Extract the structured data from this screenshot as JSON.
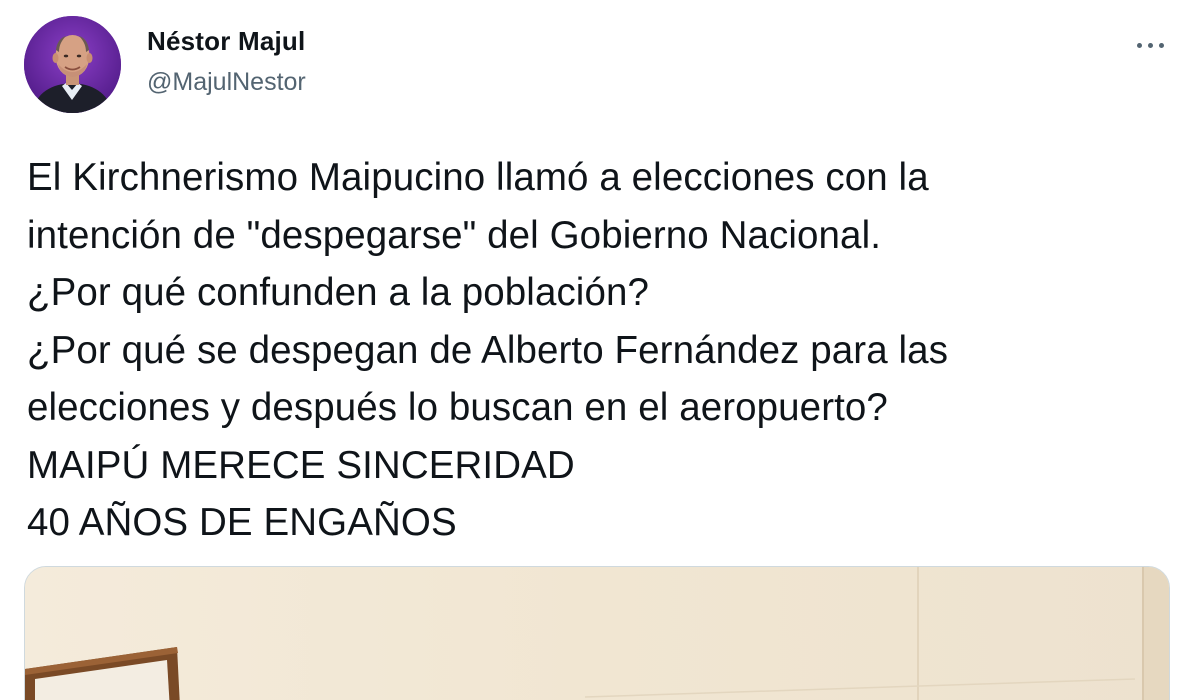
{
  "author": {
    "name": "Néstor Majul",
    "handle": "@MajulNestor",
    "avatar_icon": "profile-photo",
    "avatar_bg": "#6a2ea6"
  },
  "menu": {
    "icon": "more-horizontal-icon"
  },
  "tweet": {
    "lines": [
      "El Kirchnerismo Maipucino llamó a elecciones con la",
      "intención de \"despegarse\" del Gobierno Nacional.",
      "¿Por qué confunden a la población?",
      "¿Por qué se despegan de Alberto Fernández para las",
      "elecciones y después lo buscan en el aeropuerto?",
      "MAIPÚ MERECE SINCERIDAD",
      "40 AÑOS DE ENGAÑOS"
    ]
  },
  "colors": {
    "text_primary": "#0f1419",
    "text_secondary": "#536471",
    "media_border": "#cfd9de",
    "media_wall": "#f3e9d7"
  }
}
